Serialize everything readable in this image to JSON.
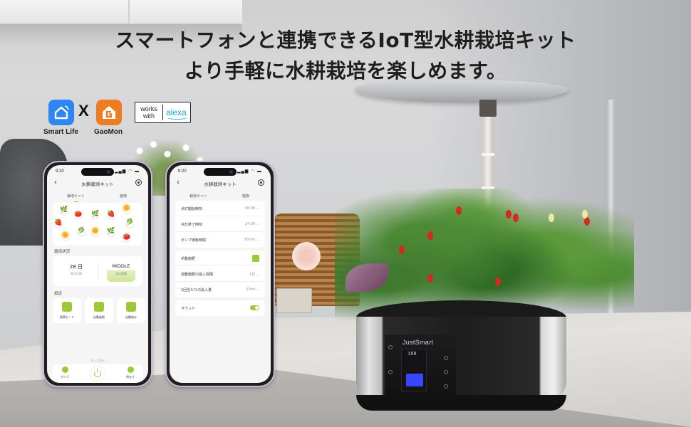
{
  "headline": {
    "line1": "スマートフォンと連携できるIoT型水耕栽培キット",
    "line2": "より手軽に水耕栽培を楽しめます。"
  },
  "logos": {
    "smart_life": {
      "label": "Smart Life",
      "color": "#2e86f5",
      "icon": "house-wifi-icon"
    },
    "separator": "X",
    "gaomon": {
      "label": "GaoMon",
      "color": "#f07c22",
      "icon": "g-house-icon"
    },
    "alexa_badge": {
      "works_with": "works with",
      "brand": "alexa",
      "color": "#1aa7d9"
    }
  },
  "product": {
    "brand": "JustSmart",
    "display_readout": "188",
    "water_level_color": "#3a45ff"
  },
  "phone_common": {
    "time": "9:20",
    "status_icons": "signal-wifi-battery",
    "title": "水耕栽培キット",
    "tabs": [
      "栽培キット",
      "植物"
    ],
    "accent_color": "#9bc93a"
  },
  "phone1": {
    "plants": [
      "🌿",
      "🍅",
      "🌿",
      "🍓",
      "🌼",
      "🍓",
      "🥬",
      "🌼",
      "🌿",
      "🍅",
      "🌼",
      "🥬"
    ],
    "status_section": "栽培状況",
    "days_value": "28 日",
    "days_label": "栽培日数",
    "water_value": "MIDDLE",
    "water_label": "水位状態",
    "settings_section": "設定",
    "tiles": [
      {
        "label": "野菜モード",
        "icon": "vegetable-mode-icon"
      },
      {
        "label": "自動施肥",
        "icon": "auto-fertilize-icon"
      },
      {
        "label": "自動給水",
        "icon": "auto-water-icon"
      }
    ],
    "more_link": "もっと見る",
    "bottom_bar": {
      "pump": "ポンプ",
      "power": "power",
      "light": "明るさ"
    }
  },
  "phone2": {
    "group1": [
      {
        "label": "点灯開始時刻",
        "value": "08:00"
      },
      {
        "label": "点灯終了時刻",
        "value": "24:00"
      },
      {
        "label": "ポンプ運転時間",
        "value": "30min"
      }
    ],
    "group2": [
      {
        "label": "手動施肥",
        "control": "button"
      },
      {
        "label": "自動施肥の投入間隔",
        "value": "5日"
      },
      {
        "label": "1回当たりの投入量",
        "value": "20ml"
      }
    ],
    "group3": [
      {
        "label": "サウンド",
        "control": "switch",
        "state": "on"
      }
    ]
  }
}
